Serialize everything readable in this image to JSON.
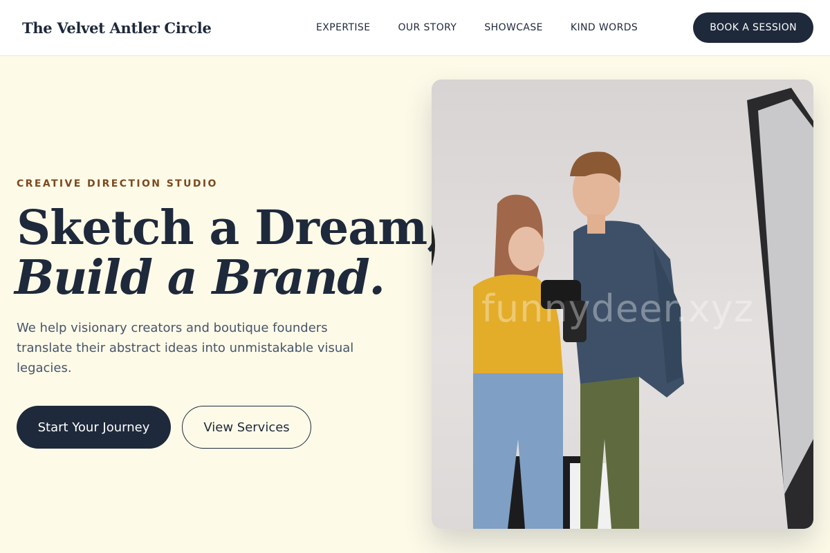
{
  "header": {
    "logo": "The Velvet Antler Circle",
    "nav": [
      "EXPERTISE",
      "OUR STORY",
      "SHOWCASE",
      "KIND WORDS"
    ],
    "cta_label": "BOOK A SESSION"
  },
  "hero": {
    "eyebrow": "CREATIVE DIRECTION STUDIO",
    "headline_line1": "Sketch a Dream,",
    "headline_line2": "Build a Brand.",
    "subtext": "We help visionary creators and boutique founders translate their abstract ideas into unmistakable visual legacies.",
    "primary_button": "Start Your Journey",
    "secondary_button": "View Services"
  },
  "photo": {
    "watermark": "funnydeer.xyz",
    "subject": "two people looking at a camera in a photo studio"
  },
  "colors": {
    "navy": "#1e293b",
    "cream_background": "#fdfae8",
    "eyebrow_brown": "#7c4a1e",
    "body_text": "#475569"
  }
}
